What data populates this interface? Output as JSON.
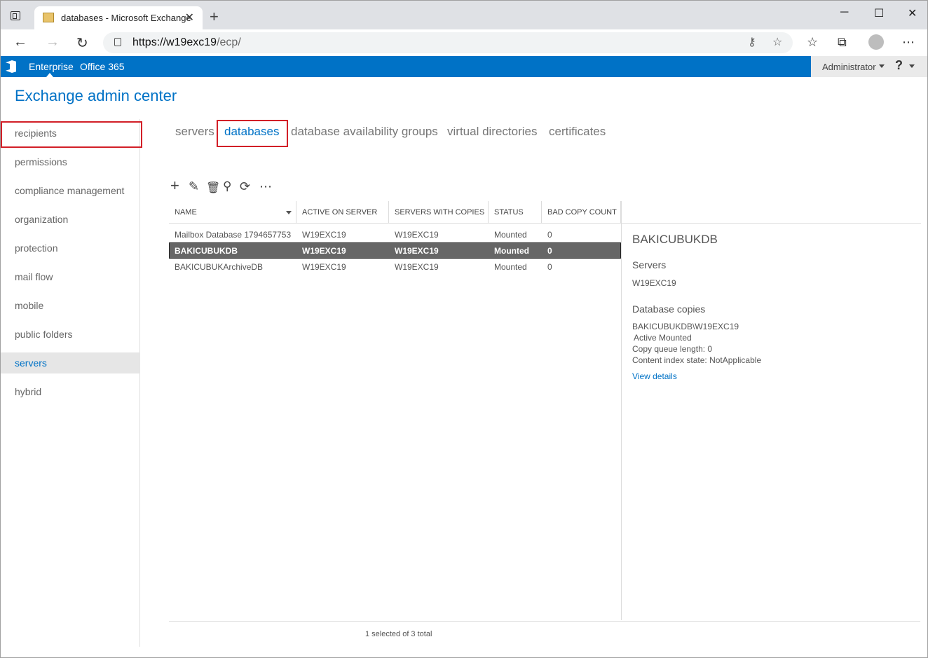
{
  "browser": {
    "tab_title": "databases - Microsoft Exchange",
    "url_host": "https://w19exc19",
    "url_path": "/ecp/"
  },
  "suitebar": {
    "enterprise": "Enterprise",
    "office365": "Office 365",
    "user": "Administrator",
    "help": "?",
    "color": "#0072c6"
  },
  "app": {
    "title": "Exchange admin center"
  },
  "nav": {
    "items": [
      "recipients",
      "permissions",
      "compliance management",
      "organization",
      "protection",
      "mail flow",
      "mobile",
      "public folders",
      "servers",
      "hybrid"
    ],
    "active": "servers"
  },
  "subtabs": [
    "servers",
    "databases",
    "database availability groups",
    "virtual directories",
    "certificates"
  ],
  "grid": {
    "columns": [
      "NAME",
      "ACTIVE ON SERVER",
      "SERVERS WITH COPIES",
      "STATUS",
      "BAD COPY COUNT"
    ],
    "rows": [
      [
        "Mailbox Database 1794657753",
        "W19EXC19",
        "W19EXC19",
        "Mounted",
        "0"
      ],
      [
        "BAKICUBUKDB",
        "W19EXC19",
        "W19EXC19",
        "Mounted",
        "0"
      ],
      [
        "BAKICUBUKArchiveDB",
        "W19EXC19",
        "W19EXC19",
        "Mounted",
        "0"
      ]
    ],
    "status": "1 selected of 3 total"
  },
  "details": {
    "title": "BAKICUBUKDB",
    "servers_label": "Servers",
    "servers_value": "W19EXC19",
    "copies_label": "Database copies",
    "copy_name": "BAKICUBUKDB\\W19EXC19",
    "copy_state": "Active Mounted",
    "copy_queue": "Copy queue length: 0",
    "content_index": "Content index state: NotApplicable",
    "view_details": "View details"
  }
}
